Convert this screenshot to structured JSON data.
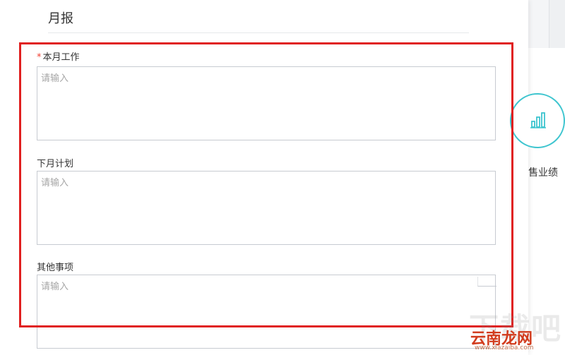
{
  "dialog": {
    "title": "月报",
    "fields": [
      {
        "label": "本月工作",
        "required": true,
        "required_mark": "*",
        "placeholder": "请输入"
      },
      {
        "label": "下月计划",
        "required": false,
        "placeholder": "请输入"
      },
      {
        "label": "其他事项",
        "required": false,
        "placeholder": "请输入"
      }
    ]
  },
  "background": {
    "card_label": "售业绩",
    "card_icon": "bar-chart-icon",
    "accent_color": "#3ec5cf"
  },
  "annotation": {
    "highlight_color": "#e02020"
  },
  "watermark": {
    "logo_text": "下载吧",
    "brand_text": "云南龙网",
    "url_text": "www.xiazaiba.com"
  }
}
